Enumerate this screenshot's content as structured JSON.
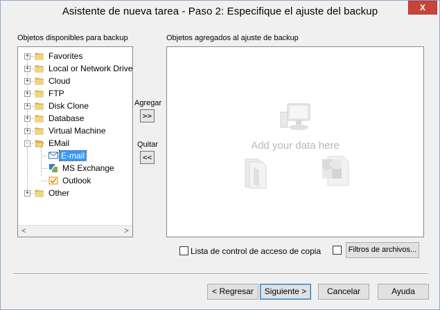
{
  "window": {
    "title": "Asistente de nueva tarea - Paso 2: Especifique el ajuste del backup",
    "close_label": "X"
  },
  "left_panel": {
    "label": "Objetos disponibles para backup",
    "tree": [
      {
        "label": "Favorites",
        "expander": "+",
        "icon": "folder-icon"
      },
      {
        "label": "Local or Network Drive",
        "expander": "+",
        "icon": "folder-icon"
      },
      {
        "label": "Cloud",
        "expander": "+",
        "icon": "folder-icon"
      },
      {
        "label": "FTP",
        "expander": "+",
        "icon": "folder-icon"
      },
      {
        "label": "Disk Clone",
        "expander": "+",
        "icon": "folder-icon"
      },
      {
        "label": "Database",
        "expander": "+",
        "icon": "folder-icon"
      },
      {
        "label": "Virtual Machine",
        "expander": "+",
        "icon": "folder-icon"
      },
      {
        "label": "EMail",
        "expander": "-",
        "icon": "folder-open-icon"
      },
      {
        "label": "E-mail",
        "icon": "envelope-icon",
        "selected": true
      },
      {
        "label": "MS Exchange",
        "icon": "exchange-icon"
      },
      {
        "label": "Outlook",
        "icon": "outlook-icon"
      },
      {
        "label": "Other",
        "expander": "+",
        "icon": "folder-icon"
      }
    ],
    "scroll_left": "<",
    "scroll_right": ">"
  },
  "middle": {
    "add_label": "Agregar",
    "add_button": ">>",
    "remove_label": "Quitar",
    "remove_button": "<<"
  },
  "right_panel": {
    "label": "Objetos agregados al ajuste de backup",
    "placeholder": "Add your data here"
  },
  "options": {
    "acl_checkbox_label": "Lista de control de acceso de copia",
    "acl_checked": false,
    "filters_checked": false,
    "filters_button": "Filtros de archivos..."
  },
  "footer": {
    "back": "< Regresar",
    "next": "Siguiente >",
    "cancel": "Cancelar",
    "help": "Ayuda"
  }
}
